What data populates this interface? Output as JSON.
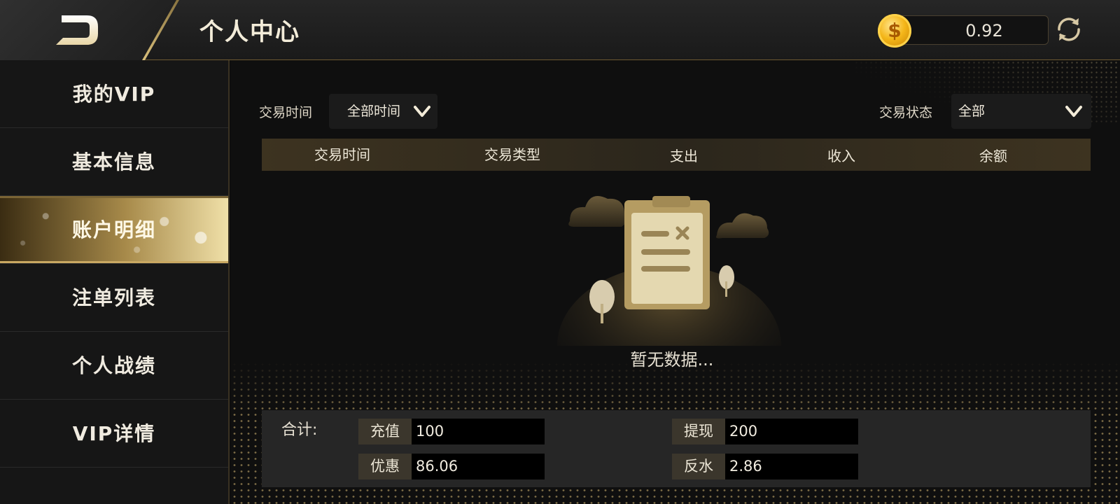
{
  "header": {
    "title": "个人中心",
    "balance": "0.92",
    "coin_symbol": "$"
  },
  "sidebar": {
    "items": [
      {
        "label": "我的VIP",
        "active": false
      },
      {
        "label": "基本信息",
        "active": false
      },
      {
        "label": "账户明细",
        "active": true
      },
      {
        "label": "注单列表",
        "active": false
      },
      {
        "label": "个人战绩",
        "active": false
      },
      {
        "label": "VIP详情",
        "active": false
      }
    ]
  },
  "filters": {
    "time_label": "交易时间",
    "time_value": "全部时间",
    "status_label": "交易状态",
    "status_value": "全部"
  },
  "table": {
    "columns": [
      "交易时间",
      "交易类型",
      "支出",
      "收入",
      "余额"
    ],
    "empty_text": "暂无数据..."
  },
  "totals": {
    "label": "合计:",
    "recharge_label": "充值",
    "recharge_value": "100",
    "withdraw_label": "提现",
    "withdraw_value": "200",
    "discount_label": "优惠",
    "discount_value": "86.06",
    "rebate_label": "反水",
    "rebate_value": "2.86"
  },
  "colors": {
    "accent_gold": "#c9a862",
    "background": "#0d0d0d"
  }
}
